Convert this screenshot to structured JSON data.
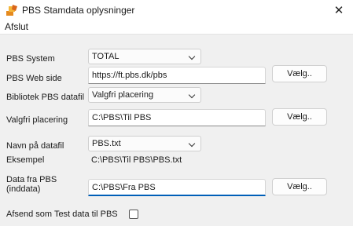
{
  "window": {
    "title": "PBS Stamdata oplysninger",
    "close_glyph": "✕"
  },
  "menu": {
    "items": [
      "Afslut"
    ]
  },
  "form": {
    "pbs_system": {
      "label": "PBS System",
      "value": "TOTAL"
    },
    "web_side": {
      "label": "PBS Web side",
      "value": "https://ft.pbs.dk/pbs",
      "button": "Vælg.."
    },
    "bibliotek": {
      "label": "Bibliotek PBS datafil",
      "value": "Valgfri placering"
    },
    "valgfri": {
      "label": "Valgfri placering",
      "value": "C:\\PBS\\Til PBS",
      "button": "Vælg.."
    },
    "navn": {
      "label": "Navn på datafil",
      "value": "PBS.txt"
    },
    "eksempel": {
      "label": "Eksempel",
      "value": "C:\\PBS\\Til PBS\\PBS.txt"
    },
    "data_fra": {
      "label_line1": "Data fra PBS",
      "label_line2": "(inddata)",
      "value": "C:\\PBS\\Fra PBS",
      "button": "Vælg.."
    },
    "test": {
      "label": "Afsend som Test data til PBS",
      "checked": false
    }
  },
  "colors": {
    "accent": "#005fb8",
    "background": "#f0f0f0"
  },
  "icons": {
    "app": "app-logo-icon",
    "close": "close-icon",
    "chevron": "chevron-down-icon"
  }
}
